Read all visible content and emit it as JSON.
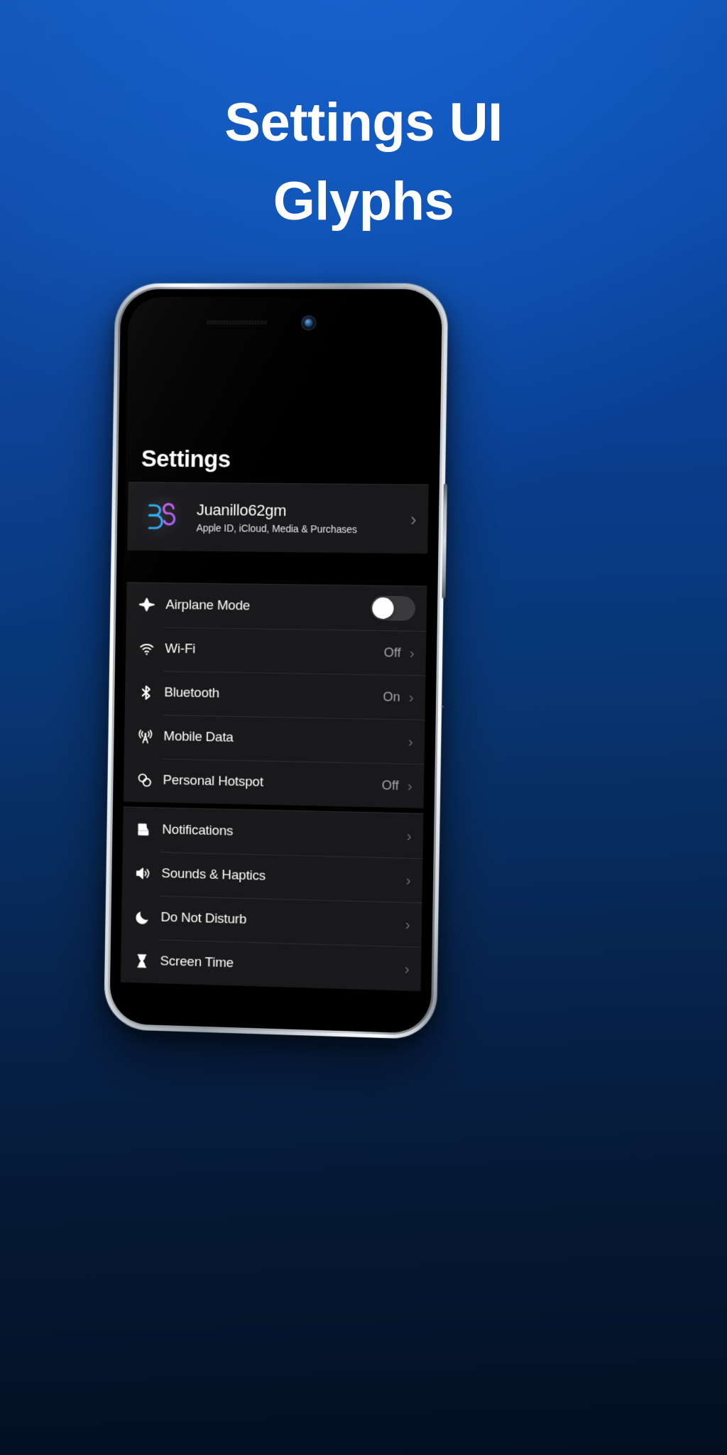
{
  "headline": {
    "line1": "Settings UI",
    "line2": "Glyphs"
  },
  "colors": {
    "background_top": "#0a4db0",
    "background_bottom": "#030e20",
    "screen_background": "#000000",
    "group_background": "#19191b",
    "accent_avatar_cyan": "#29c6f5",
    "accent_avatar_magenta": "#d45cf0",
    "value_text": "#a6a6ab",
    "toggle_track_off": "#3a3a3d",
    "toggle_knob": "#ffffff"
  },
  "phone": {
    "camera_icon": "front-camera",
    "speaker_icon": "earpiece-speaker",
    "power_button": "power-button"
  },
  "settings": {
    "nav_title": "Settings",
    "account": {
      "avatar_icon": "memoji-avatar",
      "name": "Juanillo62gm",
      "subtitle": "Apple ID, iCloud, Media & Purchases",
      "chevron": "›"
    },
    "groups": [
      {
        "name": "connectivity",
        "rows": [
          {
            "icon": "airplane-icon",
            "label": "Airplane Mode",
            "value": "",
            "control": "toggle",
            "toggle_on": false
          },
          {
            "icon": "wifi-icon",
            "label": "Wi-Fi",
            "value": "Off",
            "control": "chevron",
            "chevron": "›"
          },
          {
            "icon": "bluetooth-icon",
            "label": "Bluetooth",
            "value": "On",
            "control": "chevron",
            "chevron": "›"
          },
          {
            "icon": "antenna-icon",
            "label": "Mobile Data",
            "value": "",
            "control": "chevron",
            "chevron": "›"
          },
          {
            "icon": "hotspot-icon",
            "label": "Personal Hotspot",
            "value": "Off",
            "control": "chevron",
            "chevron": "›"
          }
        ]
      },
      {
        "name": "alerts",
        "rows": [
          {
            "icon": "notification-icon",
            "label": "Notifications",
            "value": "",
            "control": "chevron",
            "chevron": "›"
          },
          {
            "icon": "speaker-icon",
            "label": "Sounds & Haptics",
            "value": "",
            "control": "chevron",
            "chevron": "›"
          },
          {
            "icon": "moon-icon",
            "label": "Do Not Disturb",
            "value": "",
            "control": "chevron",
            "chevron": "›"
          },
          {
            "icon": "hourglass-icon",
            "label": "Screen Time",
            "value": "",
            "control": "chevron",
            "chevron": "›"
          }
        ]
      }
    ]
  }
}
